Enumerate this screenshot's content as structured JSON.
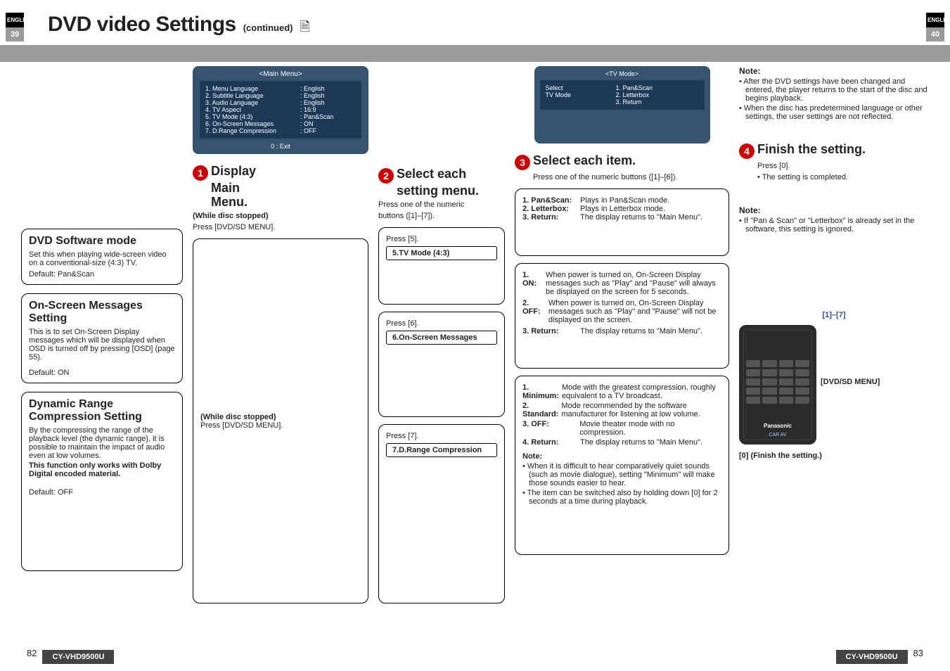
{
  "langTab": "ENGLISH",
  "pageLeft": "39",
  "pageRight": "40",
  "title": "DVD video Settings",
  "titleSub": "(continued)",
  "mainMenu": {
    "head": "<Main Menu>",
    "rows": [
      {
        "l": "1. Menu  Language",
        "r": ":  English"
      },
      {
        "l": "2. Subtitle  Language",
        "r": ":  English"
      },
      {
        "l": "3. Audio  Language",
        "r": ":  English"
      },
      {
        "l": "4. TV Aspect",
        "r": ":  16:9"
      },
      {
        "l": "5. TV Mode (4:3)",
        "r": ":  Pan&Scan"
      },
      {
        "l": "6. On-Screen Messages",
        "r": ":  ON"
      },
      {
        "l": "7. D.Range Compression",
        "r": ":  OFF"
      }
    ],
    "foot": "0  :  Exit"
  },
  "step1": {
    "t1": "Display",
    "t2": "Main Menu.",
    "s1": "(While disc stopped)",
    "s2": "Press [DVD/SD MENU].",
    "s1b": "(While disc stopped)",
    "s2b": "Press [DVD/SD MENU]."
  },
  "step2": {
    "t1": "Select each",
    "t2": "setting menu.",
    "s1": "Press  one of the numeric",
    "s2": "buttons ([1]–[7])."
  },
  "leftBoxes": [
    {
      "h": "DVD Software mode",
      "p": "Set this when playing wide-screen video on a conventional-size (4:3) TV.",
      "d": "Default: Pan&Scan"
    },
    {
      "h": "On-Screen Messages Setting",
      "p": "This is to set On-Screen Display messages which will be displayed when OSD is turned off by pressing [OSD] (page 55).",
      "d": "Default: ON"
    },
    {
      "h": "Dynamic Range Compression Setting",
      "p": "By the compressing the range of the playback level (the dynamic range), it is possible to maintain the impact of audio even at low volumes.",
      "b": "This function only works with Dolby Digital encoded material.",
      "d": "Default: OFF"
    }
  ],
  "pressBoxes": [
    {
      "pre": "Press [5].",
      "lab": "5.TV Mode (4:3)"
    },
    {
      "pre": "Press [6].",
      "lab": "6.On-Screen Messages"
    },
    {
      "pre": "Press [7].",
      "lab": "7.D.Range Compression"
    }
  ],
  "tvMode": {
    "head": "<TV Mode>",
    "left1": "Select",
    "left2": "TV Mode",
    "r1": "1. Pan&Scan",
    "r2": "2. Letterbox",
    "r3": "3. Return"
  },
  "step3": {
    "t": "Select each item.",
    "s": "Press  one of the numeric buttons ([1]–[6])."
  },
  "step4": {
    "t": "Finish the setting.",
    "s1": "Press [0].",
    "s2": "• The setting is completed."
  },
  "topNote": {
    "h": "Note:",
    "b1": "• After the DVD settings have been changed and entered, the player returns to the start of the disc and begins playback.",
    "b2": "• When the disc has predetermined language or other settings, the user settings are not reflected."
  },
  "sec1": {
    "l1": {
      "k": "1. Pan&Scan:",
      "v": "Plays in Pan&Scan mode."
    },
    "l2": {
      "k": "2. Letterbox:",
      "v": "Plays in Letterbox mode."
    },
    "l3": {
      "k": "3. Return:",
      "v": "The display returns to \"Main Menu\"."
    }
  },
  "sec1Note": {
    "h": "Note:",
    "b": "• If \"Pan & Scan\" or \"Letterbox\" is already set in the software, this setting is ignored."
  },
  "sec2": {
    "l1": {
      "k": "1. ON:",
      "v": "When power is turned on, On-Screen Display messages such as \"Play\" and \"Pause\" will always be displayed on the screen for 5 seconds."
    },
    "l2": {
      "k": "2. OFF:",
      "v": "When power is turned on, On-Screen Display messages such as \"Play\" and \"Pause\" will not be displayed on the screen."
    },
    "l3": {
      "k": "3. Return:",
      "v": "The display returns to \"Main Menu\"."
    }
  },
  "sec3": {
    "l1": {
      "k": "1. Minimum:",
      "v": "Mode with the greatest compression, roughly equivalent to a TV broadcast."
    },
    "l2": {
      "k": "2. Standard:",
      "v": "Mode recommended by the software manufacturer for listening at low volume."
    },
    "l3": {
      "k": "3. OFF:",
      "v": "Movie theater mode with no compression."
    },
    "l4": {
      "k": "4. Return:",
      "v": "The display returns to \"Main Menu\"."
    },
    "nh": "Note:",
    "n1": "• When it is difficult to hear comparatively quiet sounds (such as movie dialogue), setting \"Minimum\" will make those sounds easier to hear.",
    "n2": "• The item can be switched also by holding down [0] for 2 seconds at a time during playback."
  },
  "remote": {
    "top": "[1]–[7]",
    "side": "[DVD/SD MENU]",
    "bottom": "[0] (Finish the setting.)",
    "brand": "Panasonic",
    "brand2": "CAR AV"
  },
  "footer": {
    "model": "CY-VHD9500U",
    "pl": "82",
    "pr": "83"
  }
}
